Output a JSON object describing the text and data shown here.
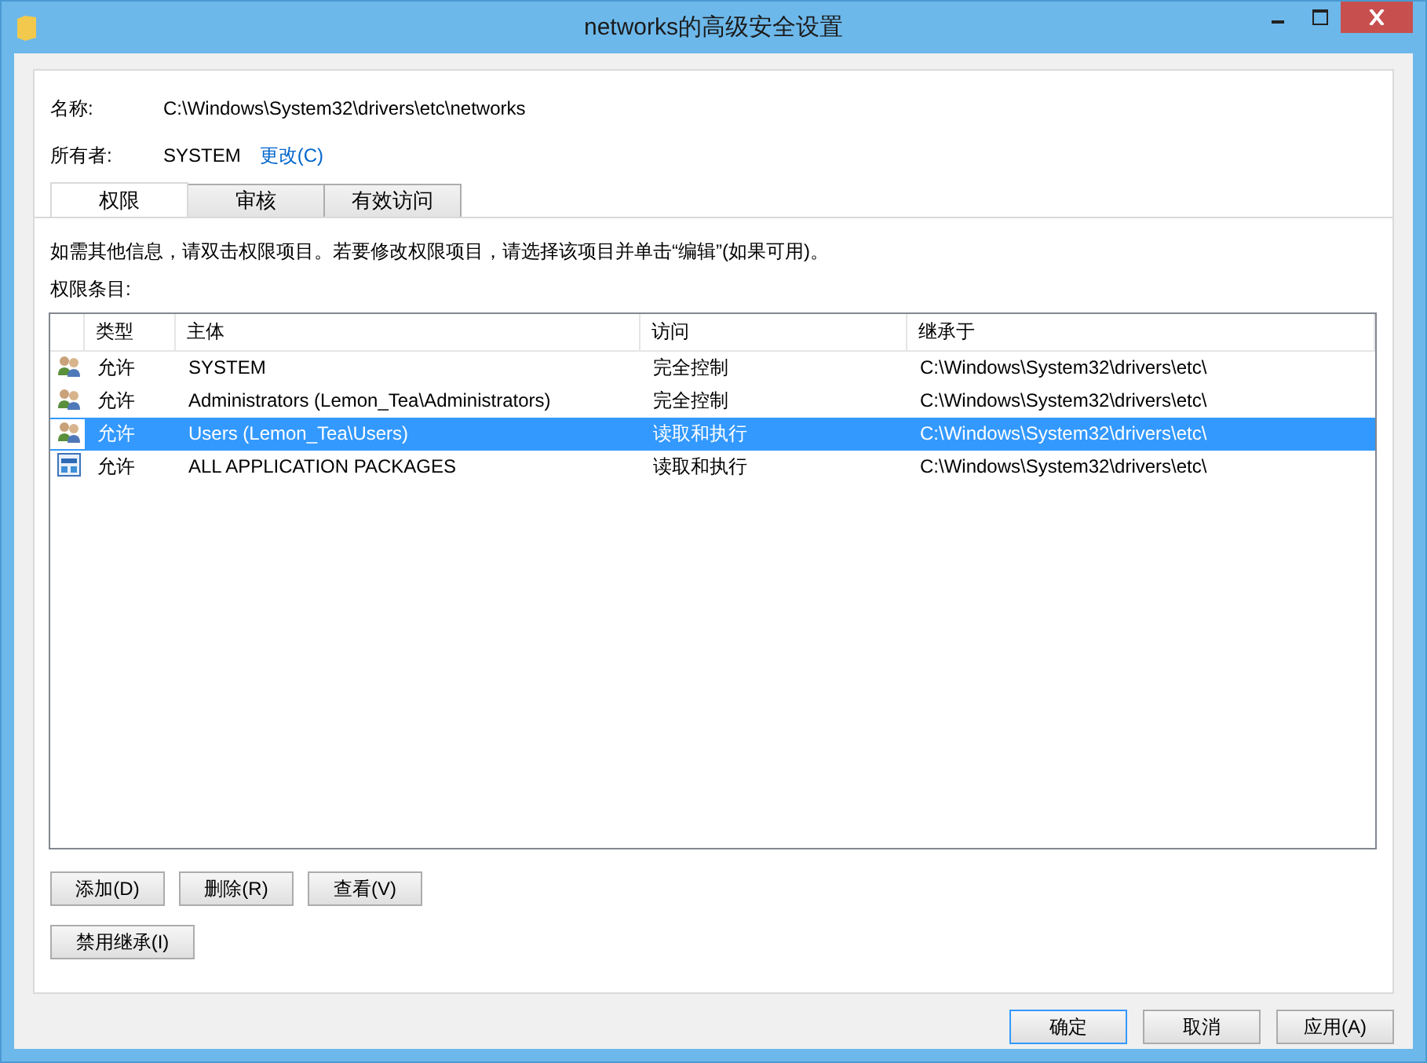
{
  "window": {
    "title": "networks的高级安全设置"
  },
  "name_label": "名称:",
  "name_value": "C:\\Windows\\System32\\drivers\\etc\\networks",
  "owner_label": "所有者:",
  "owner_value": "SYSTEM",
  "owner_change_link": "更改(C)",
  "tabs": [
    {
      "label": "权限",
      "selected": true
    },
    {
      "label": "审核",
      "selected": false
    },
    {
      "label": "有效访问",
      "selected": false
    }
  ],
  "info_text": "如需其他信息，请双击权限项目。若要修改权限项目，请选择该项目并单击“编辑”(如果可用)。",
  "entries_label": "权限条目:",
  "table": {
    "columns": [
      "类型",
      "主体",
      "访问",
      "继承于"
    ],
    "rows": [
      {
        "kind": "group",
        "selected": false,
        "cells": [
          "允许",
          "SYSTEM",
          "完全控制",
          "C:\\Windows\\System32\\drivers\\etc\\"
        ]
      },
      {
        "kind": "group",
        "selected": false,
        "cells": [
          "允许",
          "Administrators (Lemon_Tea\\Administrators)",
          "完全控制",
          "C:\\Windows\\System32\\drivers\\etc\\"
        ]
      },
      {
        "kind": "group",
        "selected": true,
        "cells": [
          "允许",
          "Users (Lemon_Tea\\Users)",
          "读取和执行",
          "C:\\Windows\\System32\\drivers\\etc\\"
        ]
      },
      {
        "kind": "package",
        "selected": false,
        "cells": [
          "允许",
          "ALL APPLICATION PACKAGES",
          "读取和执行",
          "C:\\Windows\\System32\\drivers\\etc\\"
        ]
      }
    ]
  },
  "entry_buttons": [
    "添加(D)",
    "删除(R)",
    "查看(V)"
  ],
  "inheritance_button": "禁用继承(I)",
  "dialog_buttons": [
    "确定",
    "取消",
    "应用(A)"
  ]
}
